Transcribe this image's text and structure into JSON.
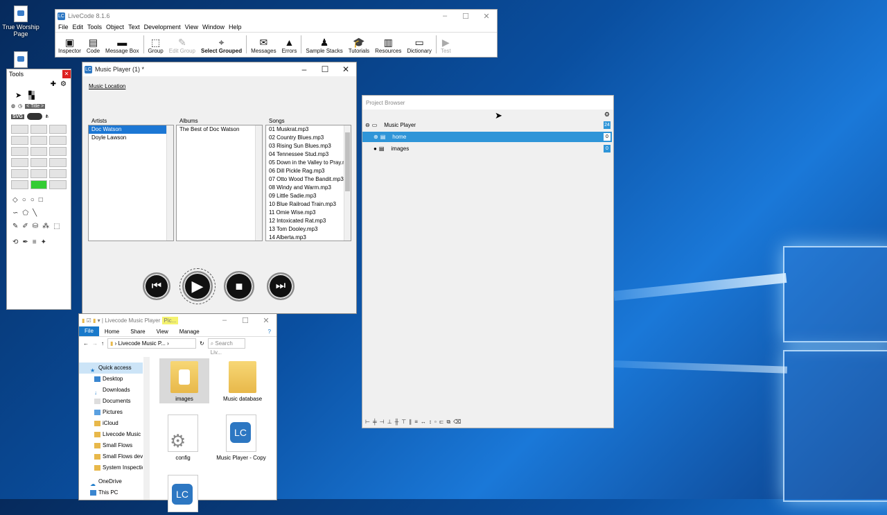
{
  "desktop": {
    "icons": [
      {
        "label": "True Worship Page"
      }
    ]
  },
  "livecode_main": {
    "title": "LiveCode 8.1.6",
    "menu": [
      "File",
      "Edit",
      "Tools",
      "Object",
      "Text",
      "Development",
      "View",
      "Window",
      "Help"
    ],
    "toolbar": [
      {
        "label": "Inspector",
        "icon": "inspector-icon"
      },
      {
        "label": "Code",
        "icon": "code-icon"
      },
      {
        "label": "Message Box",
        "icon": "message-box-icon"
      },
      {
        "label": "Group",
        "icon": "group-icon"
      },
      {
        "label": "Edit Group",
        "icon": "edit-group-icon",
        "disabled": true
      },
      {
        "label": "Select Grouped",
        "icon": "select-grouped-icon"
      },
      {
        "label": "Messages",
        "icon": "messages-icon"
      },
      {
        "label": "Errors",
        "icon": "errors-icon"
      },
      {
        "label": "Sample Stacks",
        "icon": "sample-stacks-icon"
      },
      {
        "label": "Tutorials",
        "icon": "tutorials-icon"
      },
      {
        "label": "Resources",
        "icon": "resources-icon"
      },
      {
        "label": "Dictionary",
        "icon": "dictionary-icon"
      },
      {
        "label": "Test",
        "icon": "test-icon",
        "disabled": true
      }
    ]
  },
  "tools_palette": {
    "title": "Tools",
    "tool_labels": [
      "< Title >",
      "SVG",
      "Label:"
    ]
  },
  "music_player": {
    "title": "Music Player (1) *",
    "music_location_link": "Music Location",
    "artists_label": "Artists",
    "albums_label": "Albums",
    "songs_label": "Songs",
    "artists": [
      "Doc Watson",
      "Doyle Lawson"
    ],
    "albums": [
      "The Best of Doc Watson"
    ],
    "songs": [
      "01 Muskrat.mp3",
      "02 Country Blues.mp3",
      "03 Rising Sun Blues.mp3",
      "04 Tennessee Stud.mp3",
      "05 Down in the Valley to Pray.m",
      "06 Dill Pickle Rag.mp3",
      "07 Otto Wood The Bandit.mp3",
      "08 Windy and Warm.mp3",
      "09 Little Sadie.mp3",
      "10 Blue Railroad Train.mp3",
      "11 Omie Wise.mp3",
      "12 Intoxicated Rat.mp3",
      "13 Tom Dooley.mp3",
      "14 Alberta.mp3"
    ],
    "selected_artist": "Doc Watson"
  },
  "project_browser": {
    "title": "Project Browser",
    "rows": [
      {
        "label": "Music Player",
        "count": "24"
      },
      {
        "label": "home",
        "count": "0",
        "selected": true
      },
      {
        "label": "images",
        "count": "0"
      }
    ]
  },
  "file_explorer": {
    "title": "Livecode Music Player",
    "context_tab": "Pic...",
    "ribbon": [
      "File",
      "Home",
      "Share",
      "View",
      "Manage"
    ],
    "address": "Livecode Music P...",
    "search_placeholder": "Search Liv...",
    "nav": [
      {
        "label": "Quick access",
        "icon": "star-icon"
      },
      {
        "label": "Desktop",
        "icon": "desktop-icon"
      },
      {
        "label": "Downloads",
        "icon": "download-icon"
      },
      {
        "label": "Documents",
        "icon": "documents-icon"
      },
      {
        "label": "Pictures",
        "icon": "pictures-icon"
      },
      {
        "label": "iCloud",
        "icon": "cloud-icon"
      },
      {
        "label": "Livecode Music",
        "icon": "folder-icon"
      },
      {
        "label": "Small Flows",
        "icon": "folder-icon"
      },
      {
        "label": "Small Flows dev",
        "icon": "folder-icon"
      },
      {
        "label": "System Inspectio",
        "icon": "folder-icon"
      },
      {
        "label": "OneDrive",
        "icon": "onedrive-icon"
      },
      {
        "label": "This PC",
        "icon": "pc-icon"
      }
    ],
    "items": [
      {
        "label": "images",
        "type": "folder"
      },
      {
        "label": "Music database",
        "type": "folder"
      },
      {
        "label": "config",
        "type": "file"
      },
      {
        "label": "Music Player - Copy",
        "type": "livecode"
      }
    ]
  }
}
